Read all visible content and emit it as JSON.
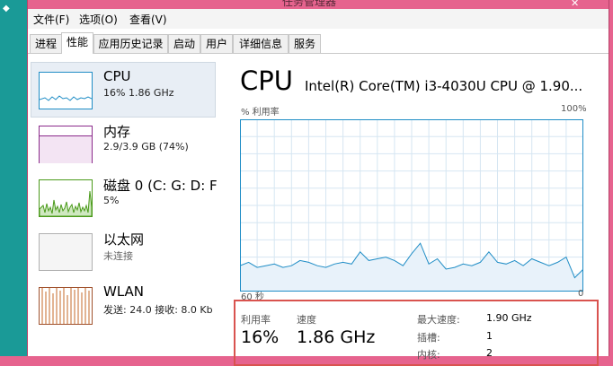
{
  "window": {
    "title": "任务管理器",
    "close_glyph": "✕"
  },
  "desktop": {
    "corner_glyph": "◆"
  },
  "menu": [
    "文件(F)",
    "选项(O)",
    "查看(V)"
  ],
  "tabs": [
    "进程",
    "性能",
    "应用历史记录",
    "启动",
    "用户",
    "详细信息",
    "服务"
  ],
  "active_tab": "性能",
  "sidebar": {
    "items": [
      {
        "title": "CPU",
        "sub": "16% 1.86 GHz",
        "color": "#1f8dc6",
        "selected": true
      },
      {
        "title": "内存",
        "sub": "2.9/3.9 GB (74%)",
        "color": "#8b2a8b",
        "selected": false
      },
      {
        "title": "磁盘 0 (C: G: D: F",
        "sub": "5%",
        "color": "#4a9a1a",
        "selected": false
      },
      {
        "title": "以太网",
        "sub": "未连接",
        "color": "#a0a0a0",
        "selected": false
      },
      {
        "title": "WLAN",
        "sub": "发送: 24.0  接收: 8.0 Kb",
        "color": "#a0522d",
        "selected": false
      }
    ]
  },
  "cpu": {
    "heading": "CPU",
    "model": "Intel(R) Core(TM) i3-4030U CPU @ 1.90...",
    "y_label": "% 利用率",
    "y_max_label": "100%",
    "x_left_label": "60 秒",
    "x_right_label": "0",
    "stats": {
      "utilization_label": "利用率",
      "utilization_value": "16%",
      "speed_label": "速度",
      "speed_value": "1.86 GHz",
      "max_speed_label": "最大速度:",
      "max_speed_value": "1.90 GHz",
      "sockets_label": "插槽:",
      "sockets_value": "1",
      "cores_label": "内核:",
      "cores_value": "2"
    }
  },
  "chart_data": {
    "type": "area",
    "title": "",
    "xlabel": "",
    "ylabel": "% 利用率",
    "xlim": [
      60,
      0
    ],
    "ylim": [
      0,
      100
    ],
    "x": [
      60,
      58.5,
      57,
      55.5,
      54,
      52.5,
      51,
      49.5,
      48,
      46.5,
      45,
      43.5,
      42,
      40.5,
      39,
      37.5,
      36,
      34.5,
      33,
      31.5,
      30,
      28.5,
      27,
      25.5,
      24,
      22.5,
      21,
      19.5,
      18,
      16.5,
      15,
      13.5,
      12,
      10.5,
      9,
      7.5,
      6,
      4.5,
      3,
      1.5,
      0
    ],
    "values": [
      15,
      17,
      14,
      15,
      16,
      14,
      15,
      18,
      17,
      15,
      14,
      16,
      17,
      16,
      23,
      18,
      19,
      20,
      18,
      15,
      22,
      28,
      16,
      19,
      13,
      14,
      16,
      15,
      17,
      23,
      17,
      16,
      18,
      15,
      19,
      17,
      15,
      17,
      20,
      8,
      13
    ],
    "colors": {
      "line": "#1f8dc6",
      "fill": "#e8f2fa",
      "grid": "#d6e6f2",
      "border": "#1f8dc6"
    }
  }
}
